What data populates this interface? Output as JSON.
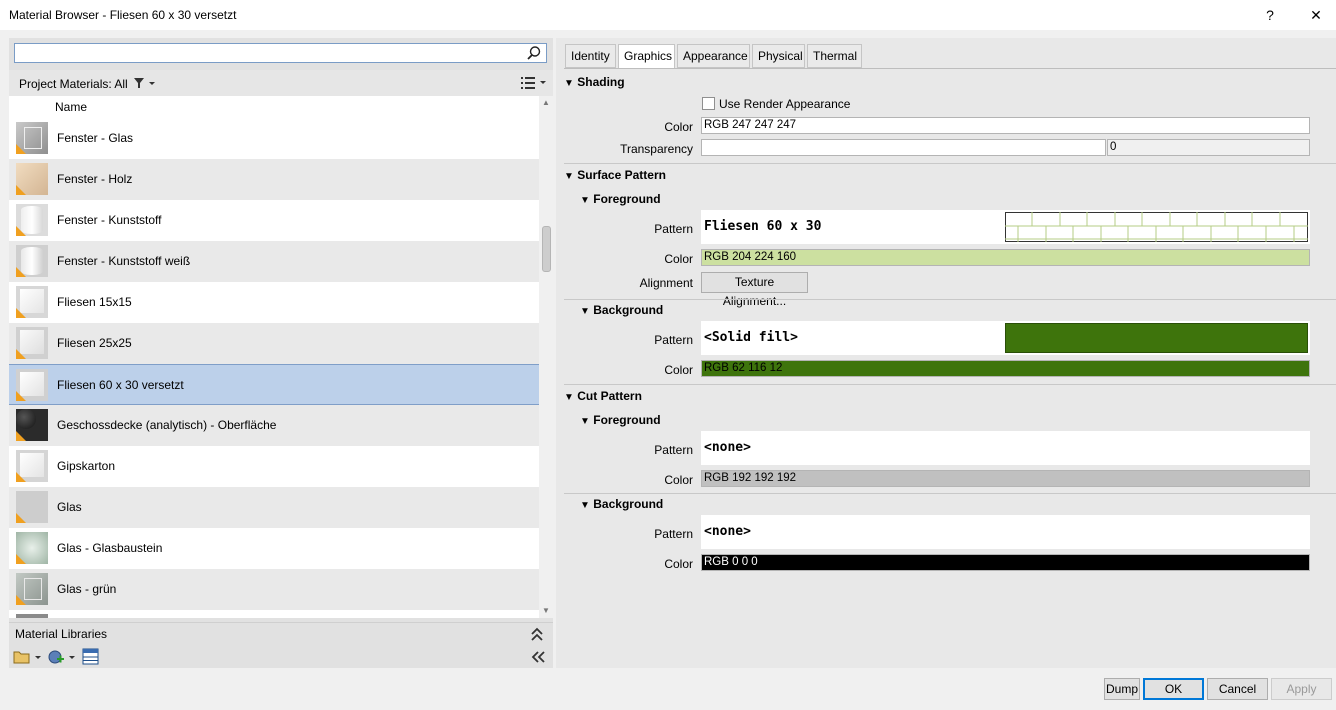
{
  "window": {
    "title": "Material Browser - Fliesen 60 x 30 versetzt",
    "help_label": "?",
    "close_label": "✕"
  },
  "left": {
    "search_placeholder": "",
    "filter_label": "Project Materials: All",
    "list_header": "Name",
    "materials": [
      {
        "label": "Fenster - Glas",
        "icon": "glass-cube-icon"
      },
      {
        "label": "Fenster - Holz",
        "icon": "wood-cube-icon"
      },
      {
        "label": "Fenster - Kunststoff",
        "icon": "white-cylinder-icon"
      },
      {
        "label": "Fenster - Kunststoff weiß",
        "icon": "white-cylinder-icon"
      },
      {
        "label": "Fliesen 15x15",
        "icon": "white-cube-icon"
      },
      {
        "label": "Fliesen 25x25",
        "icon": "white-cube-icon"
      },
      {
        "label": "Fliesen 60 x 30 versetzt",
        "icon": "white-cube-icon"
      },
      {
        "label": "Geschossdecke (analytisch) - Oberfläche",
        "icon": "black-sphere-icon"
      },
      {
        "label": "Gipskarton",
        "icon": "white-cube-icon"
      },
      {
        "label": "Glas",
        "icon": "grey-square-icon"
      },
      {
        "label": "Glas - Glasbaustein",
        "icon": "glass-block-icon"
      },
      {
        "label": "Glas - grün",
        "icon": "glass-cube-icon"
      }
    ],
    "selected_material": "Fliesen 60 x 30 versetzt",
    "material_libraries_label": "Material Libraries"
  },
  "tabs": [
    {
      "label": "Identity"
    },
    {
      "label": "Graphics",
      "active": true
    },
    {
      "label": "Appearance"
    },
    {
      "label": "Physical"
    },
    {
      "label": "Thermal"
    }
  ],
  "shading": {
    "title": "Shading",
    "use_render_label": "Use Render Appearance",
    "use_render_checked": false,
    "color_label": "Color",
    "color_value": "RGB 247 247 247",
    "transparency_label": "Transparency",
    "transparency_value": "0"
  },
  "surface": {
    "title": "Surface Pattern",
    "fg_title": "Foreground",
    "fg_pattern_label": "Pattern",
    "fg_pattern_name": "Fliesen 60 x 30",
    "fg_color_label": "Color",
    "fg_color_value": "RGB 204 224 160",
    "alignment_label": "Alignment",
    "alignment_button": "Texture Alignment...",
    "bg_title": "Background",
    "bg_pattern_label": "Pattern",
    "bg_pattern_name": "<Solid fill>",
    "bg_color_label": "Color",
    "bg_color_value": "RGB 62 116 12"
  },
  "cut": {
    "title": "Cut Pattern",
    "fg_title": "Foreground",
    "fg_pattern_label": "Pattern",
    "fg_pattern_name": "<none>",
    "fg_color_label": "Color",
    "fg_color_value": "RGB 192 192 192",
    "bg_title": "Background",
    "bg_pattern_label": "Pattern",
    "bg_pattern_name": "<none>",
    "bg_color_label": "Color",
    "bg_color_value": "RGB 0 0 0"
  },
  "colors": {
    "shading": "#f7f7f7",
    "surface_fg": "#cce0a0",
    "surface_bg": "#3e740c",
    "cut_fg": "#c0c0c0",
    "cut_bg": "#000000"
  },
  "buttons": {
    "dump": "Dump",
    "ok": "OK",
    "cancel": "Cancel",
    "apply": "Apply"
  }
}
